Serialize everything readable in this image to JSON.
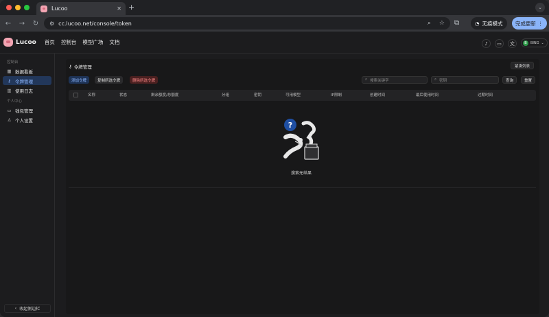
{
  "browser": {
    "tab_title": "Lucoo",
    "tab_close": "✕",
    "new_tab": "+",
    "url": "cc.lucoo.net/console/token",
    "incognito_label": "无痕模式",
    "update_label": "完成更新"
  },
  "app": {
    "brand": "Lucoo",
    "nav": [
      "首页",
      "控制台",
      "模型广场",
      "文档"
    ],
    "user_initial": "B",
    "user_name": "BING"
  },
  "sidebar": {
    "group_console": "控制台",
    "group_personal": "个人中心",
    "items": [
      {
        "label": "数据看板",
        "icon": "dashboard-icon"
      },
      {
        "label": "令牌管理",
        "icon": "key-icon",
        "active": true
      },
      {
        "label": "使用日志",
        "icon": "chart-icon"
      },
      {
        "label": "钱包管理",
        "icon": "wallet-icon"
      },
      {
        "label": "个人设置",
        "icon": "user-icon"
      }
    ],
    "collapse_label": "收起侧边栏"
  },
  "main": {
    "title": "令牌管理",
    "compact_label": "紧凑列表",
    "actions": {
      "add": "添加令牌",
      "copy": "复制所选令牌",
      "delete": "删除所选令牌"
    },
    "search": {
      "keyword_placeholder": "搜索关键字",
      "key_placeholder": "密钥",
      "query_label": "查询",
      "reset_label": "重置"
    },
    "columns": [
      "名称",
      "状态",
      "剩余额度/总额度",
      "分组",
      "密钥",
      "可用模型",
      "IP限制",
      "创建时间",
      "最后使用时间",
      "过期时间"
    ],
    "empty_text": "搜索无结果"
  },
  "colors": {
    "accent": "#8fb8ff",
    "danger": "#ff8a8a",
    "active_bg": "#22375a"
  }
}
